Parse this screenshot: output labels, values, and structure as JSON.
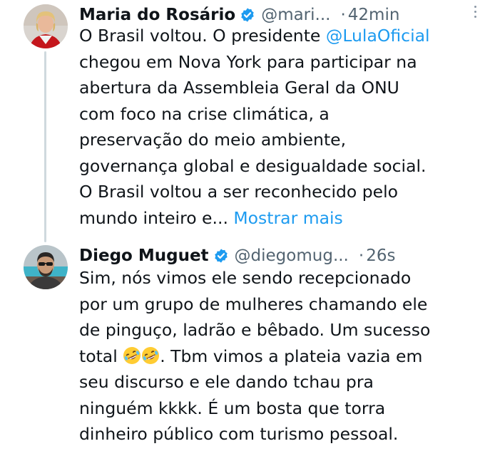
{
  "tweets": [
    {
      "author_name": "Maria do Rosário",
      "handle": "@mari...",
      "separator": "·",
      "time": "42min",
      "text_lines": [
        "O Brasil voltou. O presidente ",
        "chegou em Nova York para participar na",
        "abertura da Assembleia Geral da ONU",
        "com foco na crise climática, a",
        "preservação do meio ambiente,",
        "governança global e desigualdade social.",
        "O Brasil voltou a ser reconhecido pelo",
        "mundo inteiro e... "
      ],
      "mention": "@LulaOficial",
      "show_more": "Mostrar mais"
    },
    {
      "author_name": "Diego Muguet",
      "handle": "@diegomug...",
      "separator": "·",
      "time": "26s",
      "text_lines": [
        "Sim, nós vimos ele sendo recepcionado",
        "por um grupo de mulheres chamando ele",
        "de pinguço, ladrão e bêbado. Um sucesso",
        "total ",
        ". Tbm vimos a plateia vazia em",
        "seu discurso e ele dando tchau pra",
        "ninguém kkkk. É um bosta que torra",
        "dinheiro público com turismo pessoal."
      ]
    }
  ],
  "icons": {
    "verified": "verified-badge-icon",
    "more": "more-options-icon",
    "emoji": "rolling-on-floor-laughing-emoji"
  },
  "colors": {
    "text": "#0f1419",
    "secondary": "#536471",
    "link": "#1d9bf0",
    "verified": "#1d9bf0"
  }
}
